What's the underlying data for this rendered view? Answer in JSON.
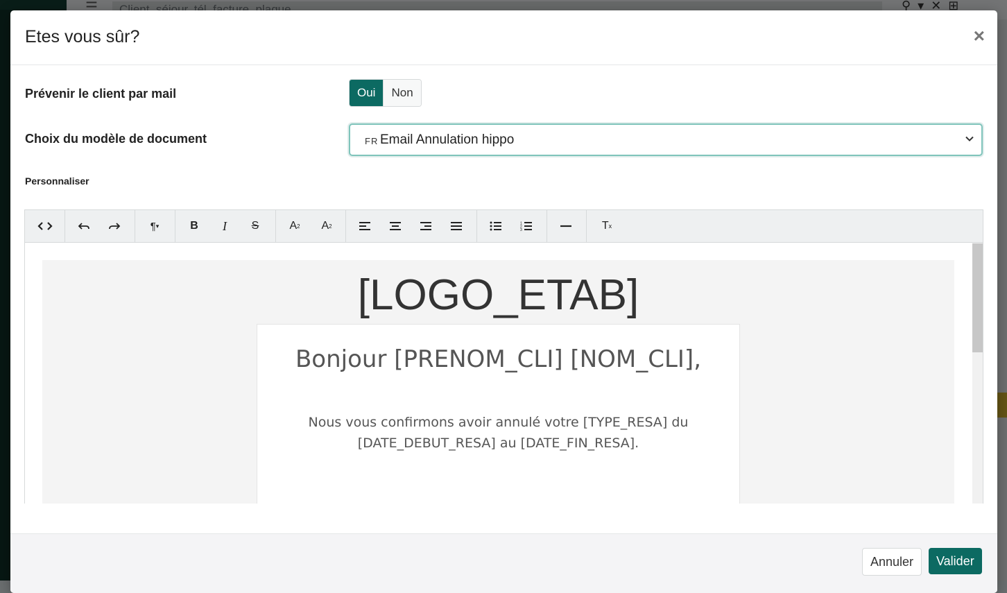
{
  "background": {
    "search_placeholder": "Client, séjour, tél, facture, plaque..."
  },
  "modal": {
    "title": "Etes vous sûr?",
    "close_label": "×"
  },
  "notify": {
    "label": "Prévenir le client par mail",
    "options": [
      "Oui",
      "Non"
    ],
    "selected": "Oui"
  },
  "template": {
    "label": "Choix du modèle de document",
    "lang": "FR",
    "value": "Email Annulation hippo"
  },
  "editor": {
    "section_label": "Personnaliser",
    "toolbar_icons": [
      "code-view-icon",
      "undo-icon",
      "redo-icon",
      "paragraph-format-icon",
      "bold-icon",
      "italic-icon",
      "strikethrough-icon",
      "superscript-icon",
      "subscript-icon",
      "align-left-icon",
      "align-center-icon",
      "align-right-icon",
      "align-justify-icon",
      "bulleted-list-icon",
      "numbered-list-icon",
      "horizontal-line-icon",
      "clear-format-icon"
    ],
    "content": {
      "logo": "[LOGO_ETAB]",
      "greeting": "Bonjour [PRENOM_CLI] [NOM_CLI],",
      "message": "Nous vous confirmons avoir annulé votre [TYPE_RESA] du [DATE_DEBUT_RESA] au [DATE_FIN_RESA]."
    }
  },
  "footer": {
    "cancel_label": "Annuler",
    "submit_label": "Valider"
  },
  "colors": {
    "accent": "#0c6a62",
    "overlay": "rgba(0,0,0,0.5)"
  }
}
